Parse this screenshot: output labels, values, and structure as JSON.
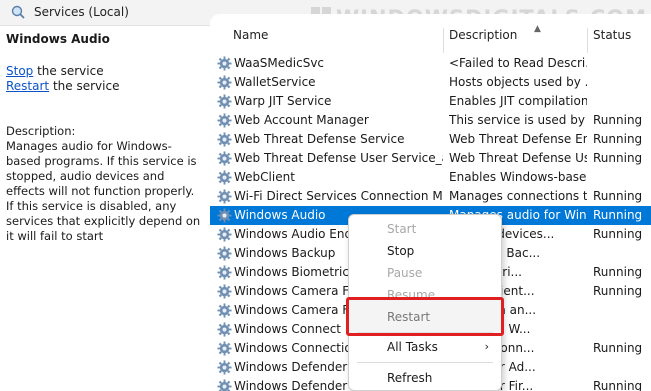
{
  "window": {
    "title": "Services (Local)",
    "watermark": "WINDOWSDIGITALS.COM"
  },
  "left_pane": {
    "service_name": "Windows Audio",
    "actions": [
      {
        "link": "Stop",
        "rest": " the service"
      },
      {
        "link": "Restart",
        "rest": " the service"
      }
    ],
    "description_label": "Description:",
    "description": "Manages audio for Windows-based programs.  If this service is stopped, audio devices and effects will not function properly.  If this service is disabled, any services that explicitly depend on it will fail to start"
  },
  "columns": {
    "name": "Name",
    "description": "Description",
    "status": "Status"
  },
  "rows": [
    {
      "name": "WaaSMedicSvc",
      "description": "<Failed to Read Descri...",
      "status": ""
    },
    {
      "name": "WalletService",
      "description": "Hosts objects used by ...",
      "status": ""
    },
    {
      "name": "Warp JIT Service",
      "description": "Enables JIT compilation...",
      "status": ""
    },
    {
      "name": "Web Account Manager",
      "description": "This service is used by ...",
      "status": "Running"
    },
    {
      "name": "Web Threat Defense Service",
      "description": "Web Threat Defense En...",
      "status": "Running"
    },
    {
      "name": "Web Threat Defense User Service_a16...",
      "description": "Web Threat Defense Us...",
      "status": "Running"
    },
    {
      "name": "WebClient",
      "description": "Enables Windows-base...",
      "status": ""
    },
    {
      "name": "Wi-Fi Direct Services Connection Ma...",
      "description": "Manages connections t...",
      "status": "Running"
    },
    {
      "name": "Windows Audio",
      "description": "Manages audio for Win...",
      "status": "Running",
      "selected": true
    },
    {
      "name": "Windows Audio Endpo",
      "description": "o audio devices...",
      "status": "Running"
    },
    {
      "name": "Windows Backup",
      "description": "Windows Bac...",
      "status": ""
    },
    {
      "name": "Windows Biometric Se",
      "description": "e biometri...",
      "status": "Running"
    },
    {
      "name": "Windows Camera Fran",
      "description": "ultiple client...",
      "status": "Running"
    },
    {
      "name": "Windows Camera Fran",
      "description": "he health an...",
      "status": ""
    },
    {
      "name": "Windows Connect No",
      "description": "hosts the W...",
      "status": ""
    },
    {
      "name": "Windows Connection",
      "description": "omatic conn...",
      "status": "Running"
    },
    {
      "name": "Windows Defender Ad",
      "description": "Defender Ad...",
      "status": ""
    },
    {
      "name": "Windows Defender Fir",
      "description": "Defender Fir...",
      "status": "Running"
    }
  ],
  "context_menu": {
    "items": [
      {
        "label": "Start",
        "enabled": false
      },
      {
        "label": "Stop",
        "enabled": true
      },
      {
        "label": "Pause",
        "enabled": false
      },
      {
        "label": "Resume",
        "enabled": false
      },
      {
        "label": "Restart",
        "enabled": true,
        "highlighted": true
      },
      {
        "label": "All Tasks",
        "enabled": true,
        "submenu_arrow": "›"
      },
      {
        "label": "Refresh",
        "enabled": true
      }
    ]
  },
  "colors": {
    "selection": "#0078d7",
    "link": "#0b53c7",
    "highlight_box": "#e02020"
  },
  "icons": {
    "window": "services-magnifier-icon",
    "service": "gear-icon",
    "watermark": "windows-logo-icon"
  }
}
